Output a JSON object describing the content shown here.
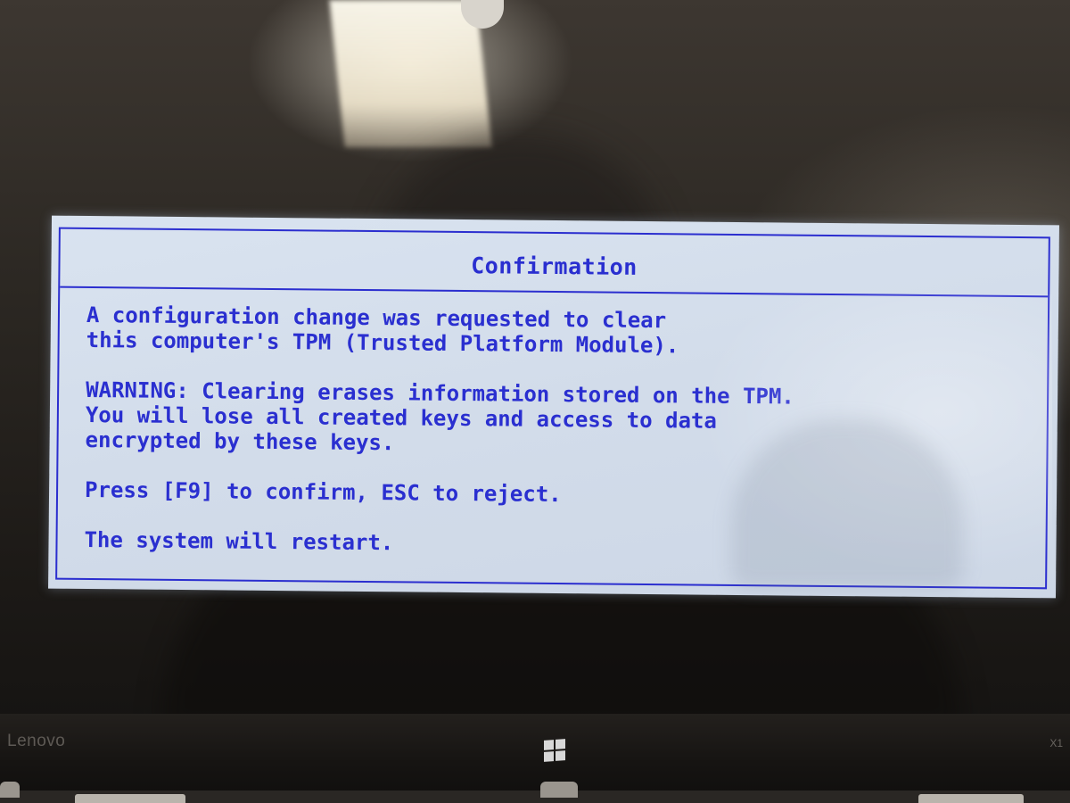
{
  "dialog": {
    "title": "Confirmation",
    "lines": [
      "A configuration change was requested to clear",
      "this computer's TPM (Trusted Platform Module).",
      "WARNING: Clearing erases information stored on the TPM.",
      "You will lose all created keys and access to data",
      "encrypted by these keys.",
      "Press [F9] to confirm, ESC to reject.",
      "The system will restart."
    ]
  },
  "device": {
    "brand": "Lenovo",
    "model": "X1",
    "windows_icon": "windows-logo-icon"
  },
  "colors": {
    "panel_background": "#d2dcea",
    "text": "#2a2fd0",
    "border": "#2b2ecf"
  }
}
